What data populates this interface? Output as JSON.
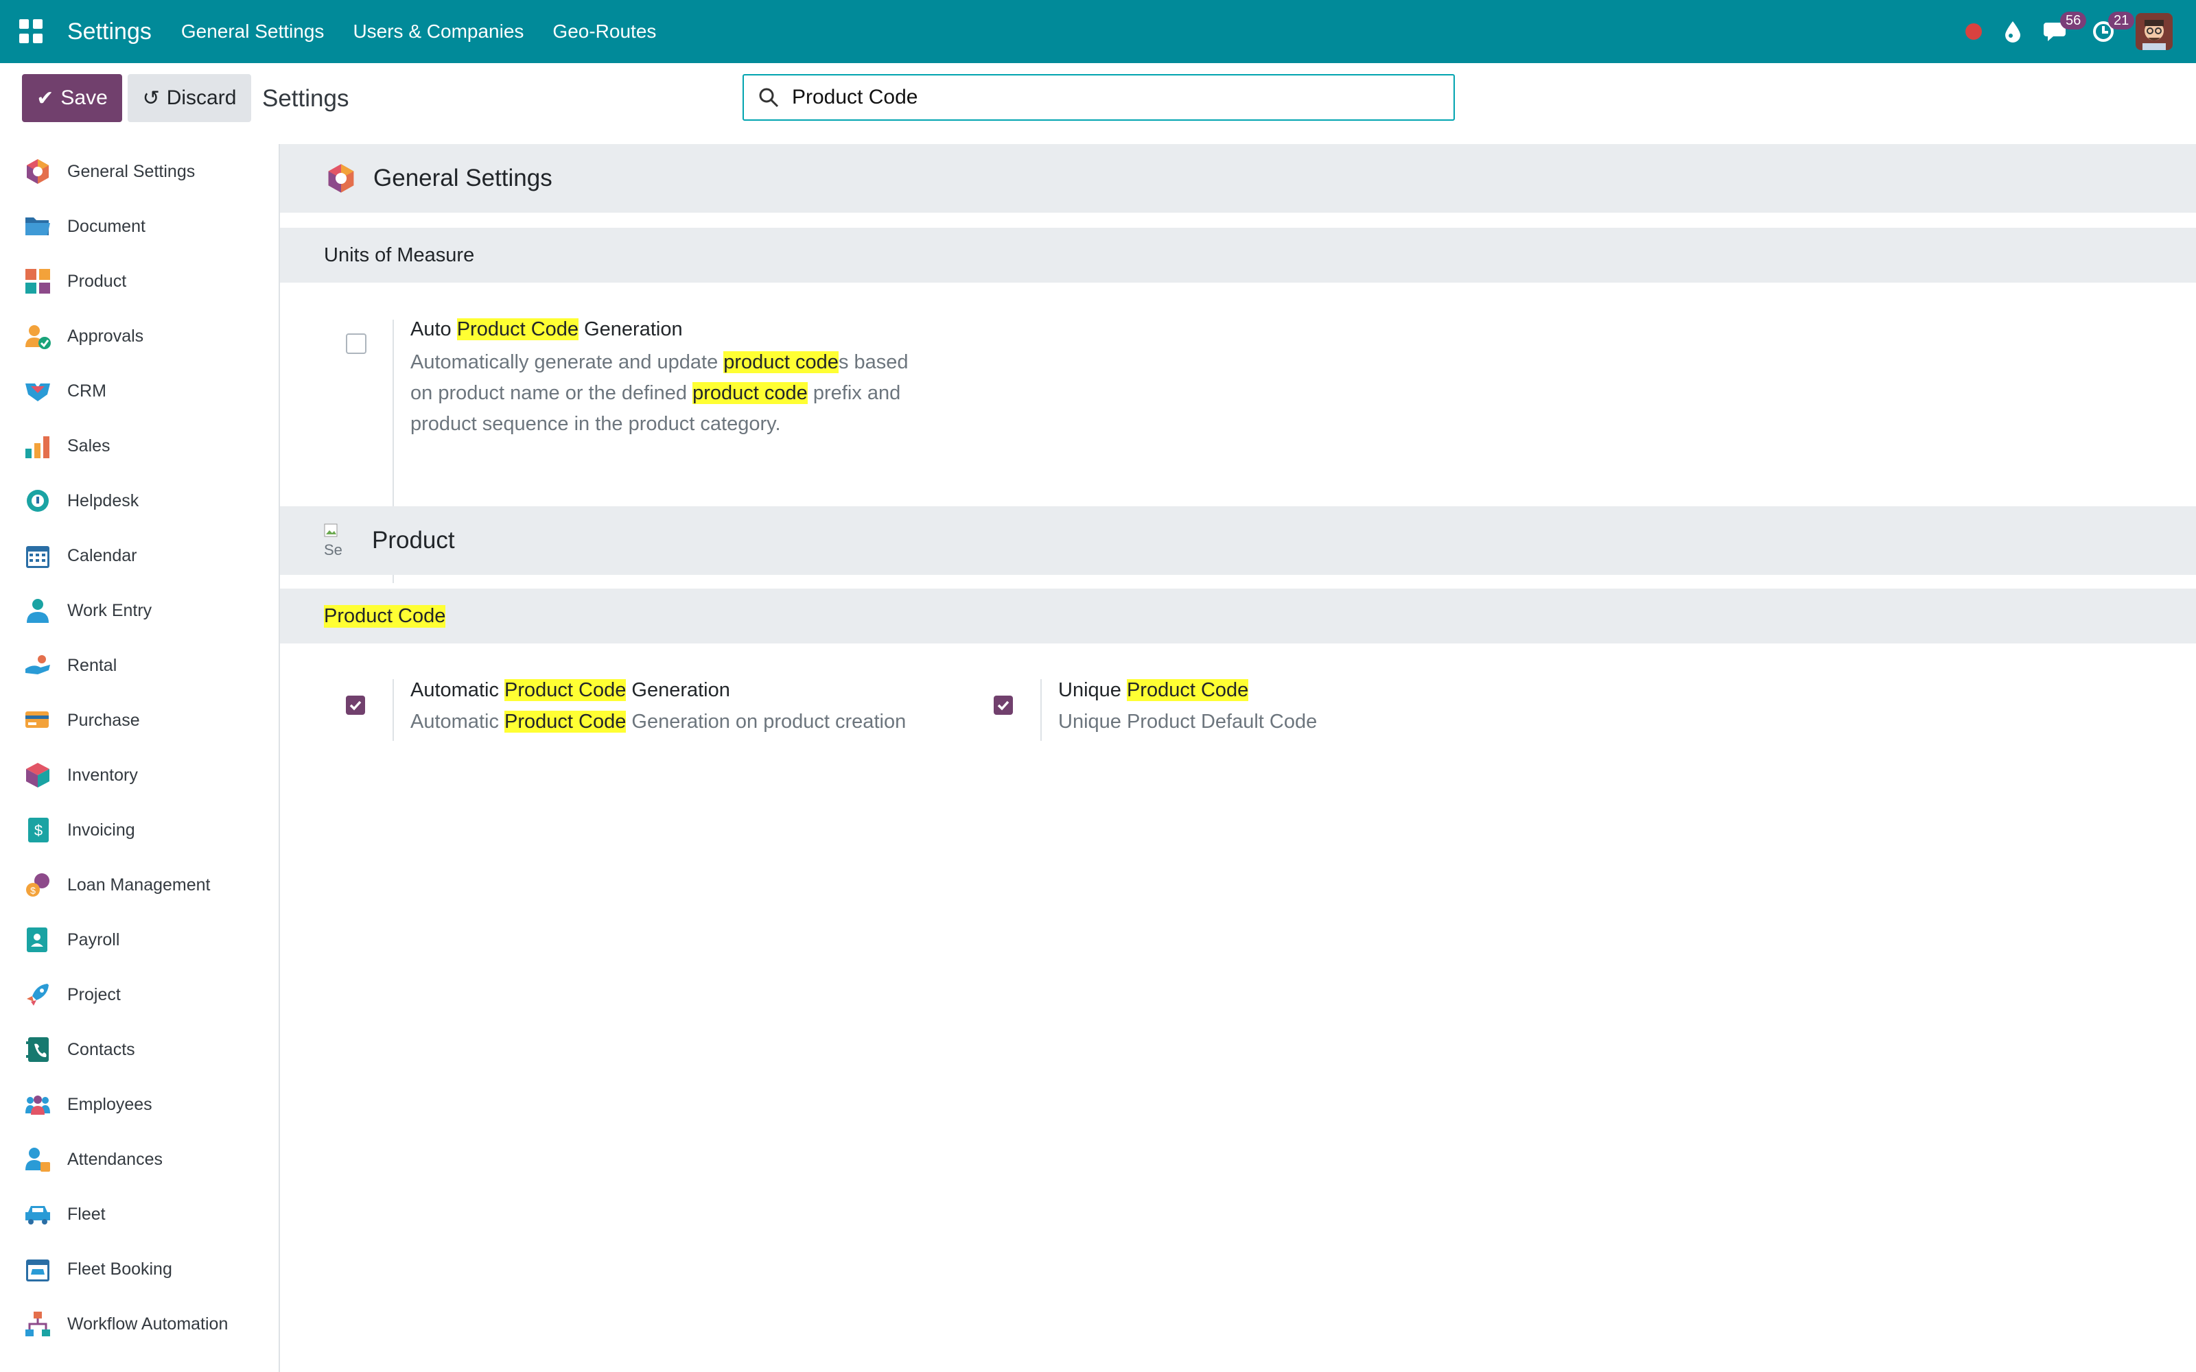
{
  "navbar": {
    "brand": "Settings",
    "menu": [
      "General Settings",
      "Users & Companies",
      "Geo-Routes"
    ],
    "chat_badge": "56",
    "activity_badge": "21",
    "accent": "#018a99"
  },
  "control_panel": {
    "save_label": "Save",
    "discard_label": "Discard",
    "title": "Settings",
    "search_value": "Product Code"
  },
  "sidebar": {
    "items": [
      {
        "label": "General Settings",
        "icon": "odoo-logo-icon"
      },
      {
        "label": "Document",
        "icon": "folder-icon"
      },
      {
        "label": "Product",
        "icon": "product-blocks-icon"
      },
      {
        "label": "Approvals",
        "icon": "approvals-user-icon"
      },
      {
        "label": "CRM",
        "icon": "crm-handshake-icon"
      },
      {
        "label": "Sales",
        "icon": "sales-chart-icon"
      },
      {
        "label": "Helpdesk",
        "icon": "helpdesk-headset-icon"
      },
      {
        "label": "Calendar",
        "icon": "calendar-icon"
      },
      {
        "label": "Work Entry",
        "icon": "work-entry-user-icon"
      },
      {
        "label": "Rental",
        "icon": "rental-hand-icon"
      },
      {
        "label": "Purchase",
        "icon": "purchase-card-icon"
      },
      {
        "label": "Inventory",
        "icon": "inventory-box-icon"
      },
      {
        "label": "Invoicing",
        "icon": "invoice-dollar-icon"
      },
      {
        "label": "Loan Management",
        "icon": "loan-coins-icon"
      },
      {
        "label": "Payroll",
        "icon": "payroll-doc-icon"
      },
      {
        "label": "Project",
        "icon": "project-rocket-icon"
      },
      {
        "label": "Contacts",
        "icon": "contacts-book-icon"
      },
      {
        "label": "Employees",
        "icon": "employees-group-icon"
      },
      {
        "label": "Attendances",
        "icon": "attendances-user-icon"
      },
      {
        "label": "Fleet",
        "icon": "fleet-car-icon"
      },
      {
        "label": "Fleet Booking",
        "icon": "fleet-booking-icon"
      },
      {
        "label": "Workflow Automation",
        "icon": "workflow-icon"
      }
    ]
  },
  "main": {
    "general_header": "General Settings",
    "uom_section": "Units of Measure",
    "auto_code": {
      "title_pre": "Auto ",
      "title_hl": "Product Code",
      "title_post": " Generation",
      "desc_1_pre": "Automatically generate and update ",
      "desc_1_hl": "product code",
      "desc_1_post": "s based",
      "desc_2_pre": "on product name or the defined ",
      "desc_2_hl": "product code",
      "desc_2_post": " prefix and",
      "desc_3": "product sequence in the product category.",
      "checked": false
    },
    "product_header": "Product",
    "product_img_alt": "Se",
    "product_code_section": "Product Code",
    "automatic_code": {
      "title_pre": "Automatic ",
      "title_hl": "Product Code",
      "title_post": " Generation",
      "desc_pre": "Automatic ",
      "desc_hl": "Product Code",
      "desc_post": " Generation on product creation",
      "checked": true
    },
    "unique_code": {
      "title_pre": "Unique ",
      "title_hl": "Product Code",
      "desc": "Unique Product Default Code",
      "checked": true
    }
  },
  "colors": {
    "primary": "#71406d",
    "highlight": "#ffff33",
    "section_bg": "#e9ecef"
  }
}
